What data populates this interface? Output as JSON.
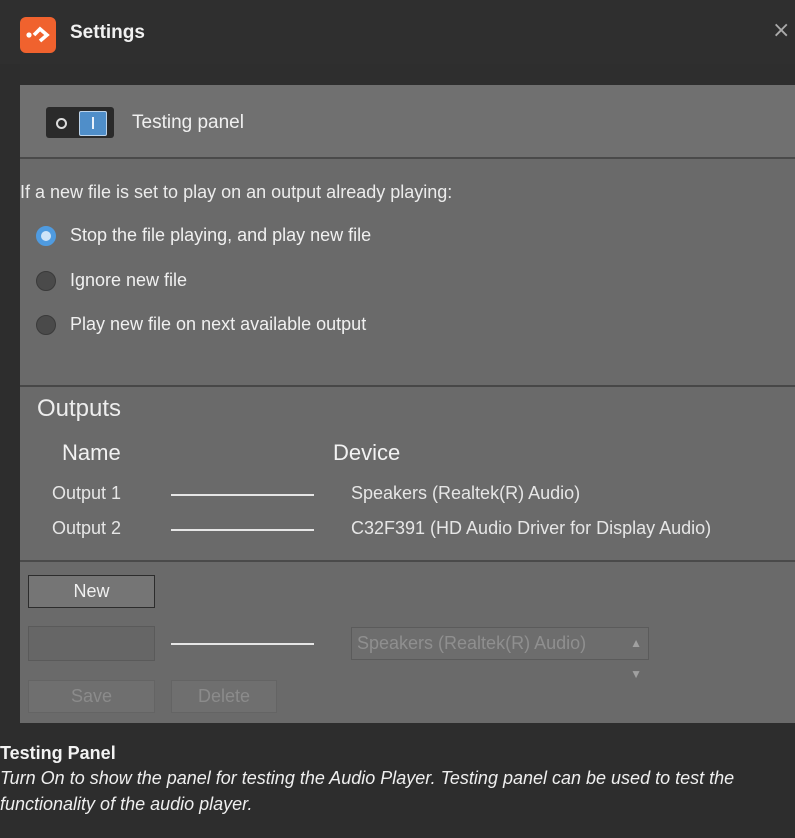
{
  "window": {
    "title": "Settings",
    "close": "×"
  },
  "toggle": {
    "label": "Testing panel",
    "state": "on"
  },
  "playback": {
    "question": "If a new file is set to play on an output already playing:",
    "options": [
      {
        "label": "Stop the file playing, and play new file",
        "selected": true
      },
      {
        "label": "Ignore new file",
        "selected": false
      },
      {
        "label": "Play new file on next available output",
        "selected": false
      }
    ]
  },
  "outputs": {
    "heading": "Outputs",
    "col_name": "Name",
    "col_device": "Device",
    "rows": [
      {
        "name": "Output 1",
        "device": "Speakers (Realtek(R) Audio)"
      },
      {
        "name": "Output 2",
        "device": "C32F391 (HD Audio Driver for Display Audio)"
      }
    ]
  },
  "editor": {
    "new_label": "New",
    "name_value": "",
    "device_selected": "Speakers (Realtek(R) Audio)",
    "save_label": "Save",
    "delete_label": "Delete"
  },
  "help": {
    "title": "Testing Panel",
    "body": "Turn On to show the panel for testing the Audio Player. Testing panel can be used to test the functionality of the audio player."
  },
  "colors": {
    "accent": "#f0622e",
    "toggle_on": "#4f8ec9",
    "radio_selected": "#4f9be0",
    "panel": "#6a6a6a"
  }
}
